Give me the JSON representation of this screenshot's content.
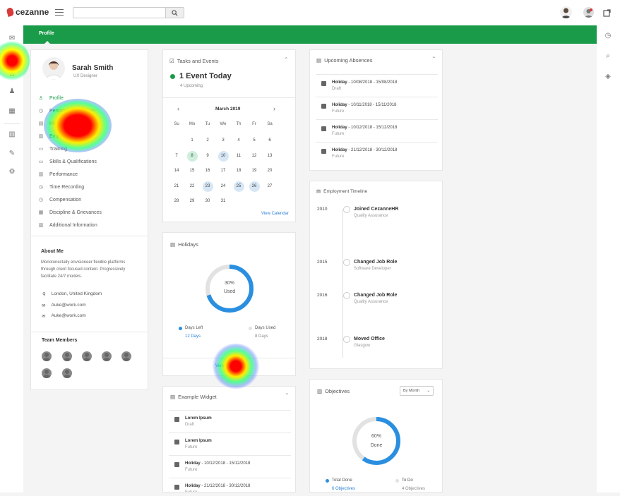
{
  "brand": {
    "name": "cezanne"
  },
  "search": {
    "placeholder": "",
    "value": ""
  },
  "greenbar": {
    "tab": "Profile"
  },
  "profile": {
    "name": "Sarah Smith",
    "role": "UX Designer",
    "nav": [
      {
        "label": "Profile",
        "icon": "person-icon",
        "glyph": "♙",
        "active": true
      },
      {
        "label": "Personal Information",
        "icon": "clock-icon",
        "glyph": "◷"
      },
      {
        "label": "History",
        "icon": "doc-icon",
        "glyph": "▤"
      },
      {
        "label": "Employment",
        "icon": "bars-icon",
        "glyph": "▥"
      },
      {
        "label": "Training",
        "icon": "screen-icon",
        "glyph": "▭"
      },
      {
        "label": "Skills & Qualifications",
        "icon": "laptop-icon",
        "glyph": "▭"
      },
      {
        "label": "Performance",
        "icon": "chart-icon",
        "glyph": "▥"
      },
      {
        "label": "Time Recording",
        "icon": "clock-icon",
        "glyph": "◷"
      },
      {
        "label": "Compensation",
        "icon": "clock-icon",
        "glyph": "◷"
      },
      {
        "label": "Discipline & Grievances",
        "icon": "building-icon",
        "glyph": "▦"
      },
      {
        "label": "Additional Information",
        "icon": "chart-icon",
        "glyph": "▥"
      }
    ],
    "about_title": "About Me",
    "about_text": "Monotonectally envisioneer flexible platforms through client focused content. Progressively facilitate 24/7 models.",
    "location": "London, United Kingdom",
    "email1": "Auke@work.com",
    "email2": "Auke@work.com",
    "team_title": "Team Members"
  },
  "tasks": {
    "title": "Tasks and Events",
    "headline": "1 Event Today",
    "sub": "4 Upcoming",
    "month": "March 2019",
    "weekdays": [
      "Su",
      "Mo",
      "Tu",
      "We",
      "Th",
      "Fr",
      "Sa"
    ],
    "weeks": [
      [
        "",
        "",
        "1",
        "2",
        "3",
        "4",
        "5",
        "6"
      ],
      [
        "7",
        "8",
        "9",
        "10",
        "11",
        "12",
        "13"
      ],
      [
        "14",
        "15",
        "16",
        "17",
        "18",
        "19",
        "20"
      ],
      [
        "21",
        "22",
        "23",
        "24",
        "25",
        "26",
        "27"
      ],
      [
        "28",
        "29",
        "30",
        "31",
        "",
        "",
        ""
      ]
    ],
    "view_calendar": "View Calendar"
  },
  "holidays": {
    "title": "Holidays",
    "percent_label": "30%",
    "used_label": "Used",
    "used_fraction": 0.3,
    "days_left_label": "Days Left",
    "days_left_value": "12 Days",
    "days_used_label": "Days Used",
    "days_used_value": "8 Days",
    "view_link": "View All"
  },
  "example": {
    "title": "Example Widget",
    "items": [
      {
        "title": "Lorem Ipsum",
        "status": "Draft"
      },
      {
        "title": "Lorem Ipsum",
        "status": "Future"
      },
      {
        "title": "Holiday",
        "dates": " - 10/12/2018 - 15/12/2018",
        "status": "Future"
      },
      {
        "title": "Holiday",
        "dates": " - 21/12/2018 - 30/12/2018",
        "status": "Future"
      }
    ]
  },
  "absences": {
    "title": "Upcoming Absences",
    "items": [
      {
        "title": "Holiday",
        "dates": " - 10/08/2018 - 15/08/2018",
        "status": "Draft"
      },
      {
        "title": "Holiday",
        "dates": " - 10/11/2018 - 15/11/2018",
        "status": "Future"
      },
      {
        "title": "Holiday",
        "dates": " - 10/12/2018 - 15/12/2018",
        "status": "Future"
      },
      {
        "title": "Holiday",
        "dates": " - 21/12/2018 - 30/12/2018",
        "status": "Future"
      }
    ]
  },
  "timeline": {
    "title": "Employment Timeline",
    "entries": [
      {
        "year": "2010",
        "title": "Joined CezanneHR",
        "sub": "Quality Assurance"
      },
      {
        "year": "2015",
        "title": "Changed Job Role",
        "sub": "Software Developer"
      },
      {
        "year": "2016",
        "title": "Changed Job Role",
        "sub": "Quality Assurance"
      },
      {
        "year": "2018",
        "title": "Moved Office",
        "sub": "Glasgow"
      }
    ]
  },
  "objectives": {
    "title": "Objectives",
    "filter": "By Month",
    "percent_label": "60%",
    "done_label": "Done",
    "done_fraction": 0.6,
    "total_done_label": "Total Done",
    "total_done_value": "6 Objectives",
    "todo_label": "To Do",
    "todo_value": "4 Objectives"
  },
  "colors": {
    "brand_green": "#1a9b4a",
    "accent_blue": "#2a8fe0",
    "ring_gray": "#e2e2e2"
  }
}
